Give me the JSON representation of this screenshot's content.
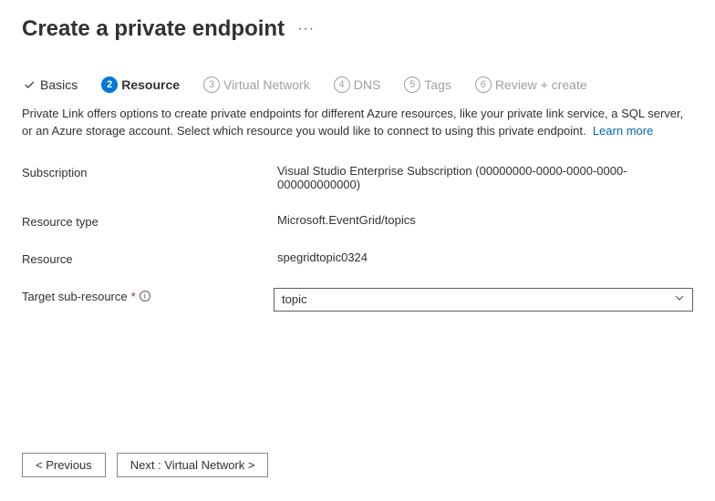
{
  "page_title": "Create a private endpoint",
  "tabs": {
    "basics": "Basics",
    "resource_num": "2",
    "resource_label": "Resource",
    "virtualnet_num": "3",
    "virtualnet_label": "Virtual Network",
    "dns_num": "4",
    "dns_label": "DNS",
    "tags_num": "5",
    "tags_label": "Tags",
    "review_num": "6",
    "review_label": "Review + create"
  },
  "description": "Private Link offers options to create private endpoints for different Azure resources, like your private link service, a SQL server, or an Azure storage account. Select which resource you would like to connect to using this private endpoint.",
  "learn_more": "Learn more",
  "fields": {
    "subscription_label": "Subscription",
    "subscription_value": "Visual Studio Enterprise Subscription (00000000-0000-0000-0000-000000000000)",
    "resource_type_label": "Resource type",
    "resource_type_value": "Microsoft.EventGrid/topics",
    "resource_label": "Resource",
    "resource_value": "spegridtopic0324",
    "target_sub_label": "Target sub-resource",
    "target_sub_value": "topic"
  },
  "footer": {
    "previous": "< Previous",
    "next": "Next : Virtual Network >"
  }
}
